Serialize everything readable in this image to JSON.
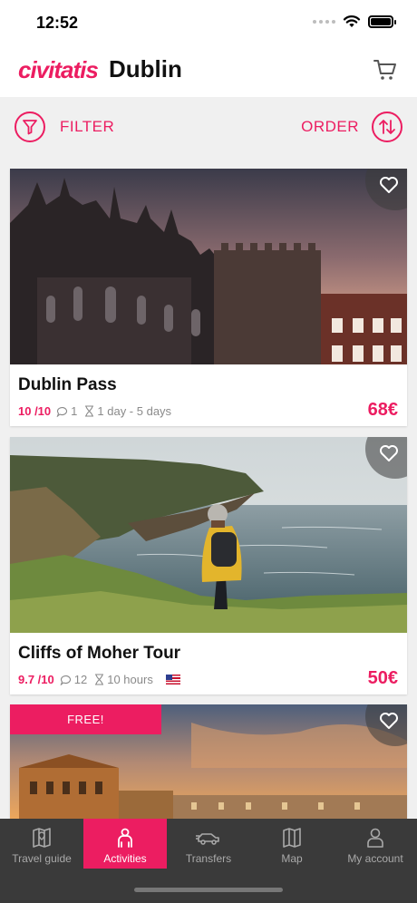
{
  "status": {
    "time": "12:52"
  },
  "header": {
    "brand": "civitatis",
    "city": "Dublin"
  },
  "filterbar": {
    "filter_label": "FILTER",
    "order_label": "ORDER"
  },
  "cards": [
    {
      "title": "Dublin Pass",
      "rating": "10 /10",
      "reviews": "1",
      "duration": "1 day - 5 days",
      "price": "68€",
      "flag": false
    },
    {
      "title": "Cliffs of Moher Tour",
      "rating": "9.7 /10",
      "reviews": "12",
      "duration": "10 hours",
      "price": "50€",
      "flag": true
    },
    {
      "badge": "FREE!"
    }
  ],
  "tabs": [
    {
      "label": "Travel guide",
      "icon": "map-book-icon"
    },
    {
      "label": "Activities",
      "icon": "person-icon"
    },
    {
      "label": "Transfers",
      "icon": "car-icon"
    },
    {
      "label": "Map",
      "icon": "map-icon"
    },
    {
      "label": "My account",
      "icon": "user-icon"
    }
  ],
  "colors": {
    "accent": "#ec1d61",
    "tabbar": "#3a3a3a"
  }
}
